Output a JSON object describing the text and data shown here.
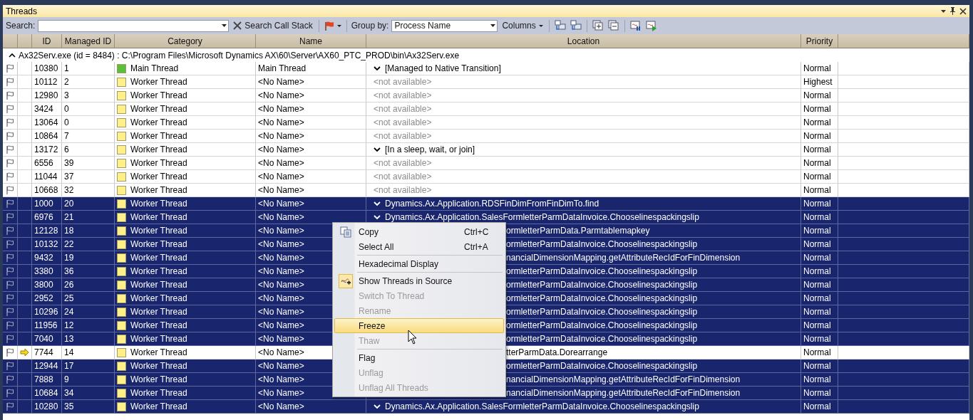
{
  "window": {
    "title": "Threads"
  },
  "toolbar": {
    "search_label": "Search:",
    "search_call_stack": "Search Call Stack",
    "group_by_label": "Group by:",
    "group_by_value": "Process Name",
    "columns_button": "Columns"
  },
  "columns": [
    "ID",
    "Managed ID",
    "Category",
    "Name",
    "Location",
    "Priority"
  ],
  "group": {
    "expanded": true,
    "label": "Ax32Serv.exe (id = 8484) : C:\\Program Files\\Microsoft Dynamics AX\\60\\Server\\AX60_PTC_PROD\\bin\\Ax32Serv.exe"
  },
  "rows": [
    {
      "id": "10380",
      "managed_id": "1",
      "category": "Main Thread",
      "color": "#5cbf3c",
      "name": "Main Thread",
      "location": {
        "kind": "frame",
        "text": "[Managed to Native Transition]"
      },
      "priority": "Normal",
      "selected": false,
      "current": false
    },
    {
      "id": "10112",
      "managed_id": "2",
      "category": "Worker Thread",
      "color": "#fff08a",
      "name": "<No Name>",
      "location": {
        "kind": "unavailable",
        "text": "<not available>"
      },
      "priority": "Highest",
      "selected": false,
      "current": false
    },
    {
      "id": "12980",
      "managed_id": "3",
      "category": "Worker Thread",
      "color": "#fff08a",
      "name": "<No Name>",
      "location": {
        "kind": "unavailable",
        "text": "<not available>"
      },
      "priority": "Normal",
      "selected": false,
      "current": false
    },
    {
      "id": "3424",
      "managed_id": "0",
      "category": "Worker Thread",
      "color": "#fff08a",
      "name": "<No Name>",
      "location": {
        "kind": "unavailable",
        "text": "<not available>"
      },
      "priority": "Normal",
      "selected": false,
      "current": false
    },
    {
      "id": "13064",
      "managed_id": "0",
      "category": "Worker Thread",
      "color": "#fff08a",
      "name": "<No Name>",
      "location": {
        "kind": "unavailable",
        "text": "<not available>"
      },
      "priority": "Normal",
      "selected": false,
      "current": false
    },
    {
      "id": "10864",
      "managed_id": "7",
      "category": "Worker Thread",
      "color": "#fff08a",
      "name": "<No Name>",
      "location": {
        "kind": "unavailable",
        "text": "<not available>"
      },
      "priority": "Normal",
      "selected": false,
      "current": false
    },
    {
      "id": "13172",
      "managed_id": "6",
      "category": "Worker Thread",
      "color": "#fff08a",
      "name": "<No Name>",
      "location": {
        "kind": "frame",
        "text": "[In a sleep, wait, or join]"
      },
      "priority": "Normal",
      "selected": false,
      "current": false
    },
    {
      "id": "6556",
      "managed_id": "39",
      "category": "Worker Thread",
      "color": "#fff08a",
      "name": "<No Name>",
      "location": {
        "kind": "unavailable",
        "text": "<not available>"
      },
      "priority": "Normal",
      "selected": false,
      "current": false
    },
    {
      "id": "11044",
      "managed_id": "37",
      "category": "Worker Thread",
      "color": "#fff08a",
      "name": "<No Name>",
      "location": {
        "kind": "unavailable",
        "text": "<not available>"
      },
      "priority": "Normal",
      "selected": false,
      "current": false
    },
    {
      "id": "10668",
      "managed_id": "32",
      "category": "Worker Thread",
      "color": "#fff08a",
      "name": "<No Name>",
      "location": {
        "kind": "unavailable",
        "text": "<not available>"
      },
      "priority": "Normal",
      "selected": false,
      "current": false
    },
    {
      "id": "1000",
      "managed_id": "20",
      "category": "Worker Thread",
      "color": "#fff08a",
      "name": "<No Name>",
      "location": {
        "kind": "frame",
        "text": "Dynamics.Ax.Application.RDSFinDimFromFinDimTo.find"
      },
      "priority": "Normal",
      "selected": true,
      "current": false
    },
    {
      "id": "6976",
      "managed_id": "21",
      "category": "Worker Thread",
      "color": "#fff08a",
      "name": "<No Name>",
      "location": {
        "kind": "frame",
        "text": "Dynamics.Ax.Application.SalesFormletterParmDataInvoice.Chooselinespackingslip"
      },
      "priority": "Normal",
      "selected": true,
      "current": false
    },
    {
      "id": "12128",
      "managed_id": "18",
      "category": "Worker Thread",
      "color": "#fff08a",
      "name": "<No Name>",
      "location": {
        "kind": "covered",
        "text": "ormletterParmData.Parmtablemapkey"
      },
      "priority": "Normal",
      "selected": true,
      "current": false
    },
    {
      "id": "10132",
      "managed_id": "22",
      "category": "Worker Thread",
      "color": "#fff08a",
      "name": "<No Name>",
      "location": {
        "kind": "covered",
        "text": "ormletterParmDataInvoice.Chooselinespackingslip"
      },
      "priority": "Normal",
      "selected": true,
      "current": false
    },
    {
      "id": "9432",
      "managed_id": "19",
      "category": "Worker Thread",
      "color": "#fff08a",
      "name": "<No Name>",
      "location": {
        "kind": "covered",
        "text": "nancialDimensionMapping.getAttributeRecIdForFinDimension"
      },
      "priority": "Normal",
      "selected": true,
      "current": false
    },
    {
      "id": "3380",
      "managed_id": "36",
      "category": "Worker Thread",
      "color": "#fff08a",
      "name": "<No Name>",
      "location": {
        "kind": "covered",
        "text": "ormletterParmDataInvoice.Chooselinespackingslip"
      },
      "priority": "Normal",
      "selected": true,
      "current": false
    },
    {
      "id": "3800",
      "managed_id": "26",
      "category": "Worker Thread",
      "color": "#fff08a",
      "name": "<No Name>",
      "location": {
        "kind": "covered",
        "text": "ormletterParmDataInvoice.Chooselinespackingslip"
      },
      "priority": "Normal",
      "selected": true,
      "current": false
    },
    {
      "id": "2952",
      "managed_id": "25",
      "category": "Worker Thread",
      "color": "#fff08a",
      "name": "<No Name>",
      "location": {
        "kind": "covered",
        "text": "ormletterParmDataInvoice.Chooselinespackingslip"
      },
      "priority": "Normal",
      "selected": true,
      "current": false
    },
    {
      "id": "10296",
      "managed_id": "24",
      "category": "Worker Thread",
      "color": "#fff08a",
      "name": "<No Name>",
      "location": {
        "kind": "covered",
        "text": "ormletterParmDataInvoice.Chooselinespackingslip"
      },
      "priority": "Normal",
      "selected": true,
      "current": false
    },
    {
      "id": "11956",
      "managed_id": "12",
      "category": "Worker Thread",
      "color": "#fff08a",
      "name": "<No Name>",
      "location": {
        "kind": "covered",
        "text": "ormletterParmDataInvoice.Chooselinespackingslip"
      },
      "priority": "Normal",
      "selected": true,
      "current": false
    },
    {
      "id": "7040",
      "managed_id": "13",
      "category": "Worker Thread",
      "color": "#fff08a",
      "name": "<No Name>",
      "location": {
        "kind": "covered",
        "text": "ormletterParmDataInvoice.Chooselinespackingslip"
      },
      "priority": "Normal",
      "selected": true,
      "current": false
    },
    {
      "id": "7744",
      "managed_id": "14",
      "category": "Worker Thread",
      "color": "#fff08a",
      "name": "<No Name>",
      "location": {
        "kind": "covered",
        "text": "tterParmData.Dorearrange"
      },
      "priority": "Normal",
      "selected": false,
      "current": true
    },
    {
      "id": "12944",
      "managed_id": "17",
      "category": "Worker Thread",
      "color": "#fff08a",
      "name": "<No Name>",
      "location": {
        "kind": "covered",
        "text": "ormletterParmDataInvoice.Chooselinespackingslip"
      },
      "priority": "Normal",
      "selected": true,
      "current": false
    },
    {
      "id": "7888",
      "managed_id": "9",
      "category": "Worker Thread",
      "color": "#fff08a",
      "name": "<No Name>",
      "location": {
        "kind": "covered",
        "text": "nancialDimensionMapping.getAttributeRecIdForFinDimension"
      },
      "priority": "Normal",
      "selected": true,
      "current": false
    },
    {
      "id": "10684",
      "managed_id": "34",
      "category": "Worker Thread",
      "color": "#fff08a",
      "name": "<No Name>",
      "location": {
        "kind": "covered",
        "text": "nancialDimensionMapping.getAttributeRecIdForFinDimension"
      },
      "priority": "Normal",
      "selected": true,
      "current": false
    },
    {
      "id": "10280",
      "managed_id": "35",
      "category": "Worker Thread",
      "color": "#fff08a",
      "name": "<No Name>",
      "location": {
        "kind": "frame",
        "text": "Dynamics.Ax.Application.SalesFormletterParmDataInvoice.Chooselinespackingslip"
      },
      "priority": "Normal",
      "selected": true,
      "current": false
    }
  ],
  "context_menu": [
    {
      "kind": "icon-command",
      "label": "Copy",
      "shortcut": "Ctrl+C",
      "disabled": false,
      "highlighted": false
    },
    {
      "kind": "command",
      "label": "Select All",
      "shortcut": "Ctrl+A",
      "disabled": false,
      "highlighted": false
    },
    {
      "kind": "separator"
    },
    {
      "kind": "toggle",
      "label": "Hexadecimal Display",
      "checked": false,
      "disabled": false,
      "highlighted": false
    },
    {
      "kind": "separator"
    },
    {
      "kind": "toggle",
      "label": "Show Threads in Source",
      "checked": true,
      "disabled": false,
      "highlighted": false
    },
    {
      "kind": "command",
      "label": "Switch To Thread",
      "disabled": true,
      "highlighted": false
    },
    {
      "kind": "command",
      "label": "Rename",
      "disabled": true,
      "highlighted": false
    },
    {
      "kind": "command",
      "label": "Freeze",
      "disabled": false,
      "highlighted": true
    },
    {
      "kind": "command",
      "label": "Thaw",
      "disabled": true,
      "highlighted": false
    },
    {
      "kind": "separator"
    },
    {
      "kind": "command",
      "label": "Flag",
      "disabled": false,
      "highlighted": false
    },
    {
      "kind": "command",
      "label": "Unflag",
      "disabled": true,
      "highlighted": false
    },
    {
      "kind": "command",
      "label": "Unflag All Threads",
      "disabled": true,
      "highlighted": false
    }
  ]
}
